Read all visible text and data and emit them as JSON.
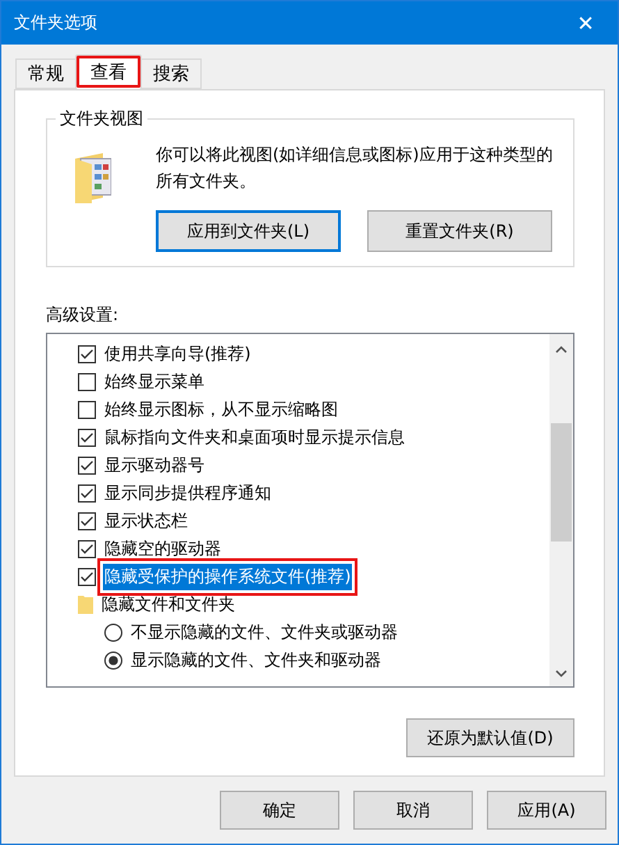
{
  "window": {
    "title": "文件夹选项",
    "close": "✕"
  },
  "tabs": [
    {
      "label": "常规",
      "selected": false,
      "annotated": false
    },
    {
      "label": "查看",
      "selected": true,
      "annotated": true
    },
    {
      "label": "搜索",
      "selected": false,
      "annotated": false
    }
  ],
  "folder_views": {
    "title": "文件夹视图",
    "description": "你可以将此视图(如详细信息或图标)应用于这种类型的所有文件夹。",
    "buttons": [
      {
        "label": "应用到文件夹(L)",
        "default": true
      },
      {
        "label": "重置文件夹(R)",
        "default": false
      }
    ]
  },
  "advanced": {
    "title": "高级设置:",
    "items": [
      {
        "kind": "checkbox",
        "label": "使用共享向导(推荐)",
        "checked": true,
        "selected": false,
        "annotated": false
      },
      {
        "kind": "checkbox",
        "label": "始终显示菜单",
        "checked": false,
        "selected": false,
        "annotated": false
      },
      {
        "kind": "checkbox",
        "label": "始终显示图标，从不显示缩略图",
        "checked": false,
        "selected": false,
        "annotated": false
      },
      {
        "kind": "checkbox",
        "label": "鼠标指向文件夹和桌面项时显示提示信息",
        "checked": true,
        "selected": false,
        "annotated": false
      },
      {
        "kind": "checkbox",
        "label": "显示驱动器号",
        "checked": true,
        "selected": false,
        "annotated": false
      },
      {
        "kind": "checkbox",
        "label": "显示同步提供程序通知",
        "checked": true,
        "selected": false,
        "annotated": false
      },
      {
        "kind": "checkbox",
        "label": "显示状态栏",
        "checked": true,
        "selected": false,
        "annotated": false
      },
      {
        "kind": "checkbox",
        "label": "隐藏空的驱动器",
        "checked": true,
        "selected": false,
        "annotated": false
      },
      {
        "kind": "checkbox",
        "label": "隐藏受保护的操作系统文件(推荐)",
        "checked": true,
        "selected": true,
        "annotated": true
      },
      {
        "kind": "group",
        "label": "隐藏文件和文件夹",
        "selected": false,
        "annotated": false,
        "children": [
          {
            "kind": "radio",
            "label": "不显示隐藏的文件、文件夹或驱动器",
            "checked": false,
            "selected": false,
            "annotated": false
          },
          {
            "kind": "radio",
            "label": "显示隐藏的文件、文件夹和驱动器",
            "checked": true,
            "selected": false,
            "annotated": false
          }
        ]
      }
    ]
  },
  "restore_button": "还原为默认值(D)",
  "footer_buttons": [
    "确定",
    "取消",
    "应用(A)"
  ]
}
